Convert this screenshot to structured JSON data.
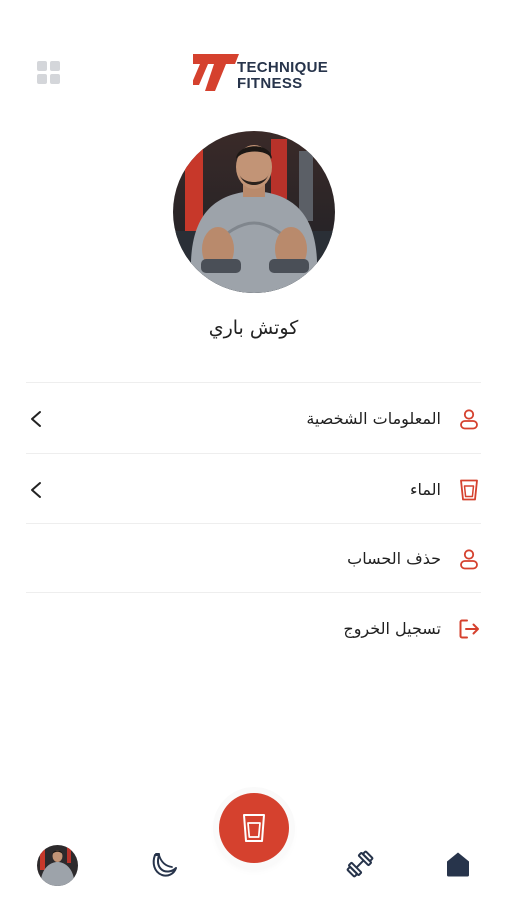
{
  "header": {
    "logo_line1": "TECHNIQUE",
    "logo_line2": "FITNESS"
  },
  "profile": {
    "name": "كوتش باري"
  },
  "menu": [
    {
      "label": "المعلومات الشخصية",
      "icon": "user-icon",
      "chevron": true
    },
    {
      "label": "الماء",
      "icon": "water-glass-icon",
      "chevron": true
    },
    {
      "label": "حذف الحساب",
      "icon": "user-icon",
      "chevron": false
    },
    {
      "label": "تسجيل الخروج",
      "icon": "logout-icon",
      "chevron": false
    }
  ],
  "bottom_nav": [
    "avatar",
    "banana-icon",
    "water-glass-icon",
    "dumbbell-icon",
    "home-icon"
  ],
  "colors": {
    "accent": "#d5412e",
    "navy": "#27344b",
    "divider": "#eeeeee"
  }
}
